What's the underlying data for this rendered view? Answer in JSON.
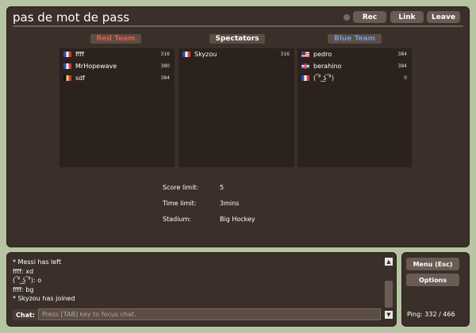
{
  "room": {
    "title": "pas de mot de pass",
    "buttons": {
      "rec": "Rec",
      "link": "Link",
      "leave": "Leave"
    }
  },
  "teams": {
    "red": {
      "label": "Red Team",
      "color": "#e35a49",
      "players": [
        {
          "name": "ffff",
          "ping": "316",
          "flag": "fr"
        },
        {
          "name": "MrHopewave",
          "ping": "380",
          "flag": "fr"
        },
        {
          "name": "sdf",
          "ping": "384",
          "flag": "be"
        }
      ]
    },
    "spectators": {
      "label": "Spectators",
      "players": [
        {
          "name": "Skyzou",
          "ping": "316",
          "flag": "fr"
        }
      ]
    },
    "blue": {
      "label": "Blue Team",
      "color": "#6f98d6",
      "players": [
        {
          "name": "pedro",
          "ping": "384",
          "flag": "us"
        },
        {
          "name": "berahino",
          "ping": "384",
          "flag": "gb"
        },
        {
          "name": "( ͡° ͜ʖ ͡°)",
          "ping": "0",
          "flag": "fr"
        }
      ]
    }
  },
  "settings": {
    "score_limit": {
      "label": "Score limit:",
      "value": "5"
    },
    "time_limit": {
      "label": "Time limit:",
      "value": "3mins"
    },
    "stadium": {
      "label": "Stadium:",
      "value": "Big Hockey"
    }
  },
  "chat": {
    "messages": [
      "* Messi has left",
      "ffff: xd",
      "( ͡° ͜ʖ ͡°): o",
      "ffff: bg",
      "* Skyzou has joined"
    ],
    "label": "Chat:",
    "placeholder": "Press [TAB] key to focus chat."
  },
  "side": {
    "menu": "Menu (Esc)",
    "options": "Options",
    "ping": "Ping: 332 / 466"
  }
}
